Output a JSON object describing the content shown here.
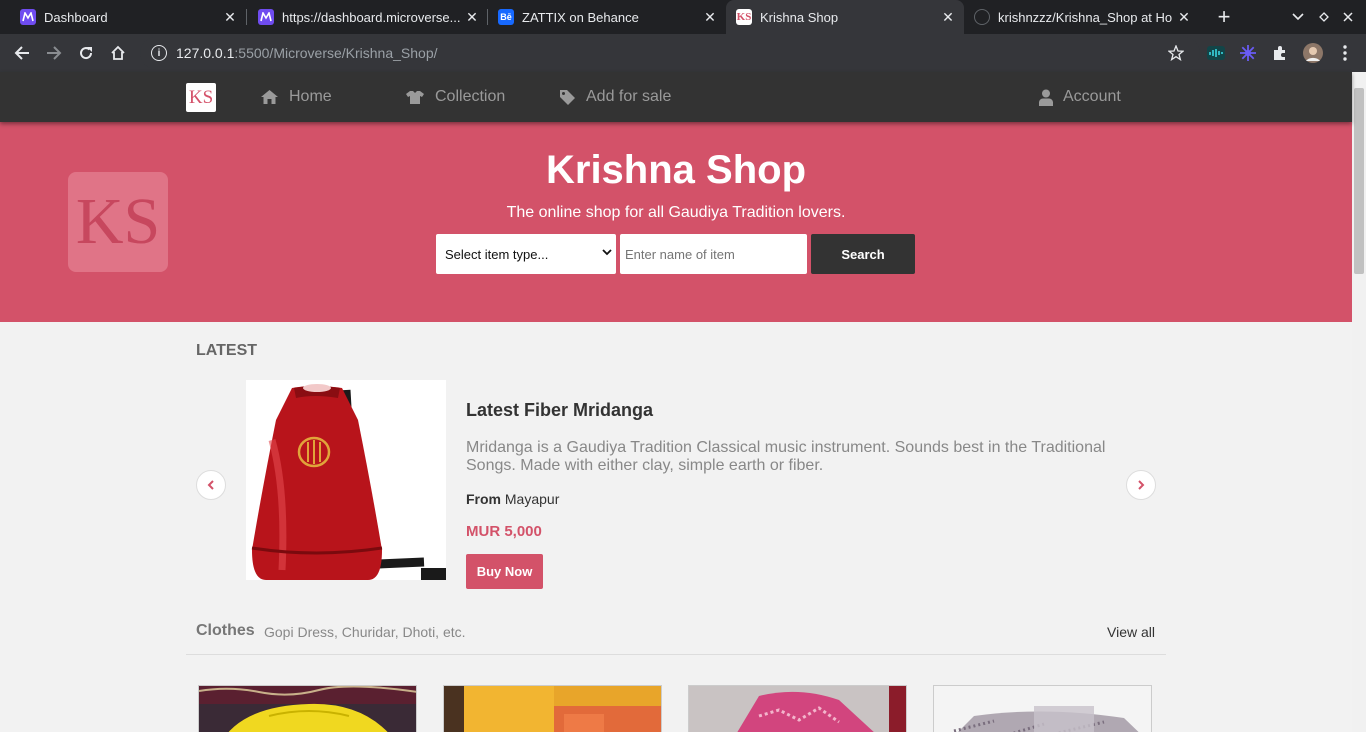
{
  "browser": {
    "tabs": [
      {
        "title": "Dashboard",
        "icon": "microverse-icon"
      },
      {
        "title": "https://dashboard.microverse...",
        "icon": "microverse-icon"
      },
      {
        "title": "ZATTIX on Behance",
        "icon": "behance-icon",
        "icon_text": "Bē"
      },
      {
        "title": "Krishna Shop",
        "icon": "ks-icon",
        "icon_text": "KS",
        "active": true
      },
      {
        "title": "krishnzzz/Krishna_Shop at Ho",
        "icon": "github-icon"
      }
    ],
    "url_host": "127.0.0.1",
    "url_path": ":5500/Microverse/Krishna_Shop/"
  },
  "nav": {
    "logo": "KS",
    "home": "Home",
    "collection": "Collection",
    "add_for_sale": "Add for sale",
    "account": "Account"
  },
  "hero": {
    "logo": "KS",
    "title": "Krishna Shop",
    "subtitle": "The online shop for all Gaudiya Tradition lovers.",
    "select_value": "Select item type...",
    "input_placeholder": "Enter name of item",
    "search_label": "Search"
  },
  "latest": {
    "label": "LATEST",
    "product": {
      "title": "Latest Fiber Mridanga",
      "description": "Mridanga is a Gaudiya Tradition Classical music instrument. Sounds best in the Traditional Songs. Made with either clay, simple earth or fiber.",
      "from_label": "From",
      "from_value": "Mayapur",
      "price": "MUR 5,000",
      "buy_label": "Buy Now"
    }
  },
  "clothes": {
    "title": "Clothes",
    "subtitle": "Gopi Dress, Churidar, Dhoti, etc.",
    "view_all": "View all"
  },
  "colors": {
    "brand": "#d35269",
    "nav_bg": "#333333",
    "page_bg": "#f2f2f2"
  }
}
